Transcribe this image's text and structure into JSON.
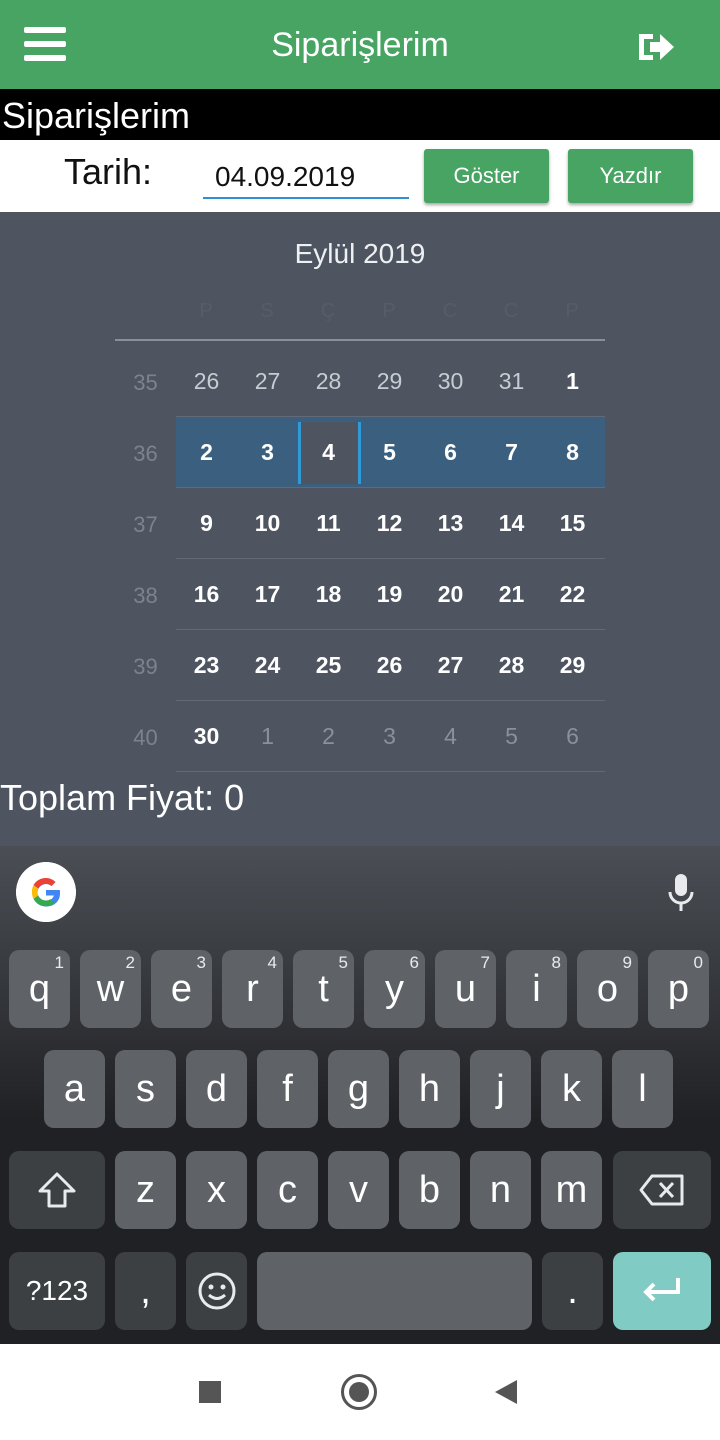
{
  "app": {
    "title": "Siparişlerim",
    "section_title": "Siparişlerim"
  },
  "date_row": {
    "label": "Tarih:",
    "date_value": "04.09.2019",
    "show_button": "Göster",
    "print_button": "Yazdır"
  },
  "calendar": {
    "month_title": "Eylül 2019",
    "weekdays": [
      "P",
      "S",
      "Ç",
      "P",
      "C",
      "C",
      "P"
    ],
    "weeks": [
      {
        "number": "35",
        "days": [
          "26",
          "27",
          "28",
          "29",
          "30",
          "31",
          "1"
        ]
      },
      {
        "number": "36",
        "days": [
          "2",
          "3",
          "4",
          "5",
          "6",
          "7",
          "8"
        ]
      },
      {
        "number": "37",
        "days": [
          "9",
          "10",
          "11",
          "12",
          "13",
          "14",
          "15"
        ]
      },
      {
        "number": "38",
        "days": [
          "16",
          "17",
          "18",
          "19",
          "20",
          "21",
          "22"
        ]
      },
      {
        "number": "39",
        "days": [
          "23",
          "24",
          "25",
          "26",
          "27",
          "28",
          "29"
        ]
      },
      {
        "number": "40",
        "days": [
          "30",
          "1",
          "2",
          "3",
          "4",
          "5",
          "6"
        ]
      }
    ],
    "selected_week": "36",
    "selected_day": "4"
  },
  "total": {
    "label": "Toplam Fiyat: 0"
  },
  "keyboard": {
    "row1": [
      {
        "char": "q",
        "num": "1"
      },
      {
        "char": "w",
        "num": "2"
      },
      {
        "char": "e",
        "num": "3"
      },
      {
        "char": "r",
        "num": "4"
      },
      {
        "char": "t",
        "num": "5"
      },
      {
        "char": "y",
        "num": "6"
      },
      {
        "char": "u",
        "num": "7"
      },
      {
        "char": "i",
        "num": "8"
      },
      {
        "char": "o",
        "num": "9"
      },
      {
        "char": "p",
        "num": "0"
      }
    ],
    "row2": [
      "a",
      "s",
      "d",
      "f",
      "g",
      "h",
      "j",
      "k",
      "l"
    ],
    "row3": [
      "z",
      "x",
      "c",
      "v",
      "b",
      "n",
      "m"
    ],
    "symbols_key": "?123",
    "comma_key": ",",
    "period_key": ".",
    "icons": {
      "shift": "shift-icon",
      "backspace": "backspace-icon",
      "emoji": "emoji-icon",
      "enter": "enter-icon",
      "mic": "mic-icon",
      "google": "google-icon"
    },
    "enter_color": "#80cbc4"
  },
  "colors": {
    "primary": "#47a463",
    "calendar_bg": "#4e5561",
    "selected_week": "#3b607f",
    "today_border": "#2f9ad6"
  }
}
